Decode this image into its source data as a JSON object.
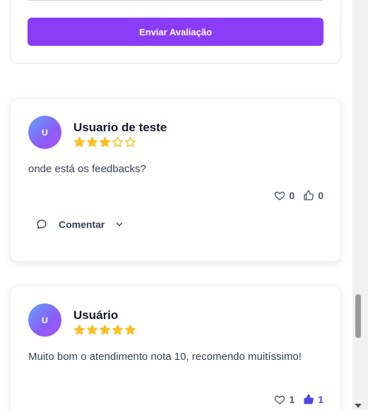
{
  "form": {
    "submit_label": "Enviar Avaliação"
  },
  "reviews": [
    {
      "avatar_initial": "U",
      "name": "Usuario de teste",
      "rating": 3,
      "max_rating": 5,
      "text": "onde está os feedbacks?",
      "hearts": "0",
      "likes": "0",
      "liked": false,
      "comment_label": "Comentar"
    },
    {
      "avatar_initial": "U",
      "name": "Usuário",
      "rating": 5,
      "max_rating": 5,
      "text": "Muito bom o atendimento nota 10, recomendo muitíssimo!",
      "hearts": "1",
      "likes": "1",
      "liked": true
    }
  ],
  "colors": {
    "accent": "#8b3cf6",
    "star": "#fbbf24",
    "liked": "#4f46e5"
  },
  "scrollbar": {
    "position_fraction": 0.81
  }
}
